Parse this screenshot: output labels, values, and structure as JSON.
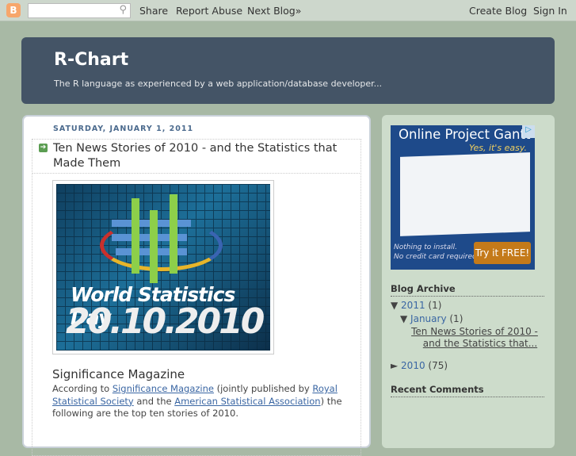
{
  "navbar": {
    "search_placeholder": "",
    "share": "Share",
    "report_abuse": "Report Abuse",
    "next_blog": "Next Blog»",
    "create_blog": "Create Blog",
    "sign_in": "Sign In"
  },
  "header": {
    "title": "R-Chart",
    "description": "The R language as experienced by a web application/database developer..."
  },
  "post": {
    "date": "SATURDAY, JANUARY 1, 2011",
    "title": "Ten News Stories of 2010 - and the Statistics that Made Them",
    "image": {
      "line1": "World Statistics Day",
      "line2": "20.10.2010"
    },
    "subheading": "Significance Magazine",
    "body": {
      "t1": "According to ",
      "l1": "Significance Magazine",
      "t2": " (jointly published by ",
      "l2": "Royal Statistical Society",
      "t3": " and the ",
      "l3": "American Statistical Association",
      "t4": ") the following are the top ten stories of 2010."
    }
  },
  "sidebar": {
    "ad": {
      "title": "Online Project Gantt",
      "tagline": "Yes, it's easy.",
      "note1": "Nothing to install.",
      "note2": "No credit card required.",
      "button": "Try it FREE!"
    },
    "archive_title": "Blog Archive",
    "archive": {
      "y2011": "2011",
      "y2011_count": "(1)",
      "jan": "January",
      "jan_count": "(1)",
      "post_link": "Ten News Stories of 2010 - and the Statistics that...",
      "y2010": "2010",
      "y2010_count": "(75)"
    },
    "recent_comments_title": "Recent Comments"
  }
}
